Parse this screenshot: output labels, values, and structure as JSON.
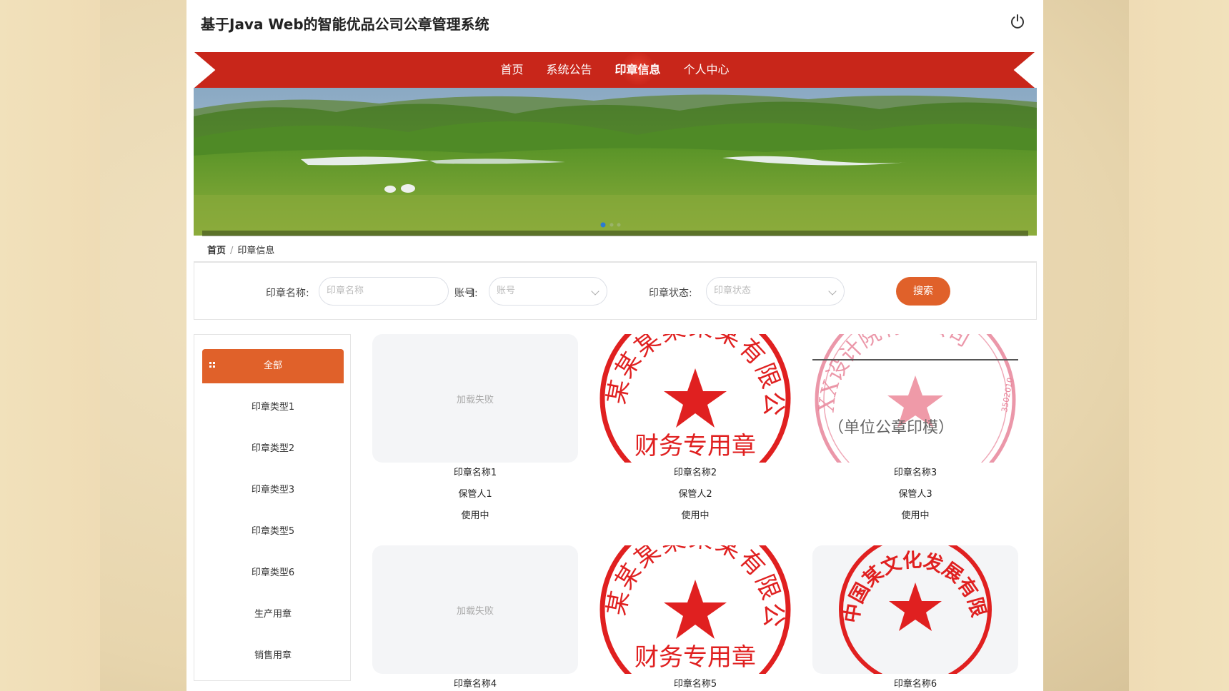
{
  "header": {
    "title": "基于Java Web的智能优品公司公章管理系统"
  },
  "nav": {
    "items": [
      {
        "label": "首页"
      },
      {
        "label": "系统公告"
      },
      {
        "label": "印章信息"
      },
      {
        "label": "个人中心"
      }
    ],
    "active": "印章信息"
  },
  "breadcrumb": {
    "home": "首页",
    "separator": "/",
    "current": "印章信息"
  },
  "search": {
    "name_label": "印章名称:",
    "name_placeholder": "印章名称",
    "account_label": "账号:",
    "account_placeholder": "账号",
    "status_label": "印章状态:",
    "status_placeholder": "印章状态",
    "button_label": "搜索"
  },
  "sidebar": {
    "items": [
      {
        "label": "全部"
      },
      {
        "label": "印章类型1"
      },
      {
        "label": "印章类型2"
      },
      {
        "label": "印章类型3"
      },
      {
        "label": "印章类型5"
      },
      {
        "label": "印章类型6"
      },
      {
        "label": "生产用章"
      },
      {
        "label": "销售用章"
      }
    ]
  },
  "cards": [
    {
      "name": "印章名称1",
      "keeper": "保管人1",
      "status": "使用中",
      "image": "load-failed",
      "fail_text": "加载失败"
    },
    {
      "name": "印章名称2",
      "keeper": "保管人2",
      "status": "使用中",
      "image": "finance-seal"
    },
    {
      "name": "印章名称3",
      "keeper": "保管人3",
      "status": "使用中",
      "image": "unit-seal-template"
    },
    {
      "name": "印章名称4",
      "image": "load-failed",
      "fail_text": "加载失败"
    },
    {
      "name": "印章名称5",
      "image": "finance-seal"
    },
    {
      "name": "印章名称6",
      "image": "company-seal"
    }
  ],
  "seals": {
    "finance": {
      "top_text": "某某某某某某有限公司",
      "bottom_text": "财务专用章"
    },
    "unit": {
      "top_text": "XX设计院有限公司",
      "center_text": "（单位公章印模）",
      "side_text": "3502010"
    },
    "company": {
      "top_text": "中国某文化发展有限责任公司"
    }
  },
  "colors": {
    "nav_red": "#c8261a",
    "accent_orange": "#e0612a",
    "seal_red": "#e02020"
  }
}
